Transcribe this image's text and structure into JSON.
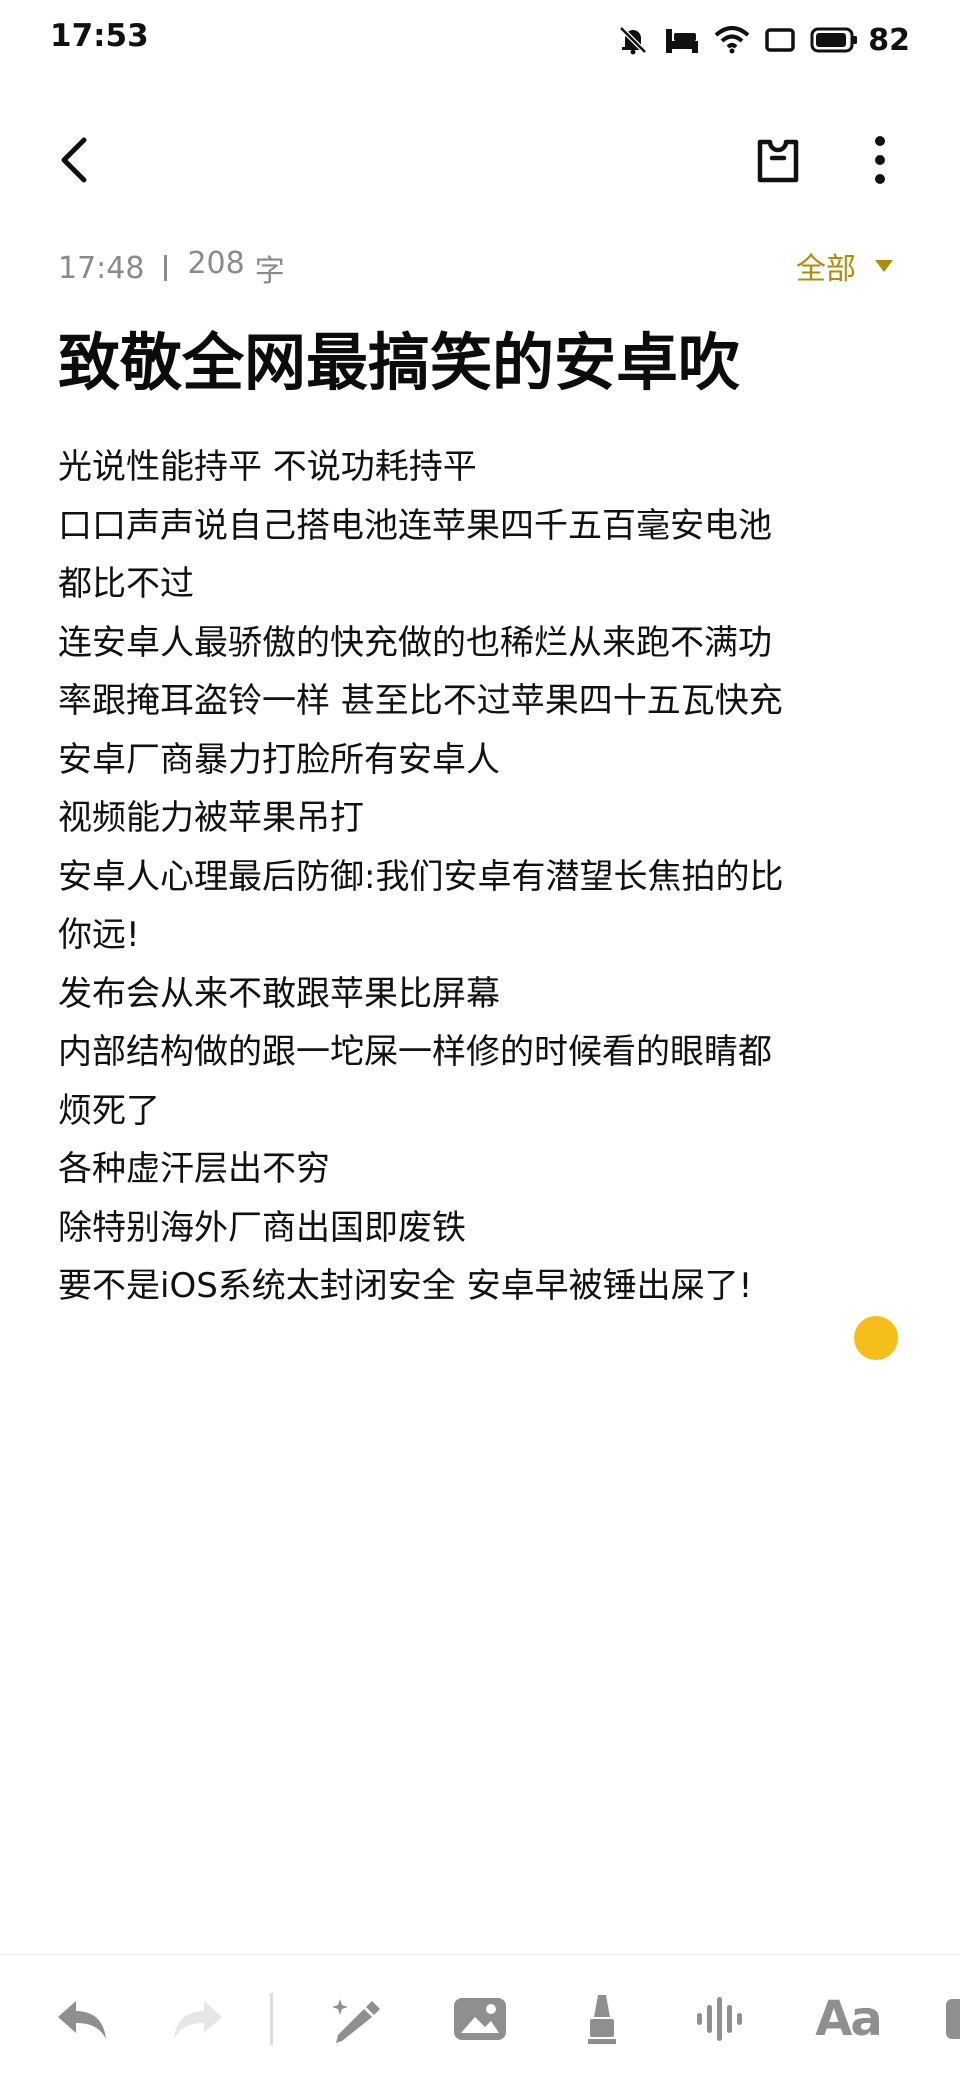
{
  "status_bar": {
    "time": "17:53",
    "battery_level": "82",
    "icons": [
      "mute-icon",
      "sleep-icon",
      "wifi-icon",
      "screen-icon",
      "battery-icon"
    ]
  },
  "nav": {
    "icons": [
      "back-arrow-icon",
      "clip-icon",
      "more-vertical-icon"
    ]
  },
  "meta": {
    "time": "17:48",
    "word_count": "208",
    "word_unit": "字"
  },
  "category": {
    "label": "全部",
    "color": "#b08a0a"
  },
  "note": {
    "title": "致敬全网最搞笑的安卓吹",
    "lines": [
      "光说性能持平 不说功耗持平",
      "口口声声说自己搭电池连苹果四千五百毫安电池",
      "都比不过",
      "连安卓人最骄傲的快充做的也稀烂从来跑不满功",
      "率跟掩耳盗铃一样 甚至比不过苹果四十五瓦快充",
      "安卓厂商暴力打脸所有安卓人",
      "视频能力被苹果吊打",
      "安卓人心理最后防御:我们安卓有潜望长焦拍的比",
      "你远!",
      "发布会从来不敢跟苹果比屏幕",
      "内部结构做的跟一坨屎一样修的时候看的眼睛都",
      "烦死了",
      "各种虚汗层出不穷",
      "除特别海外厂商出国即废铁",
      "要不是iOS系统太封闭安全 安卓早被锤出屎了!"
    ]
  },
  "cursor_color": "#f6be1a",
  "toolbar": {
    "font_label": "Aa",
    "icons": [
      "undo-icon",
      "redo-icon",
      "pen-icon",
      "image-icon",
      "highlighter-icon",
      "audio-wave-icon",
      "text-format-icon"
    ]
  }
}
